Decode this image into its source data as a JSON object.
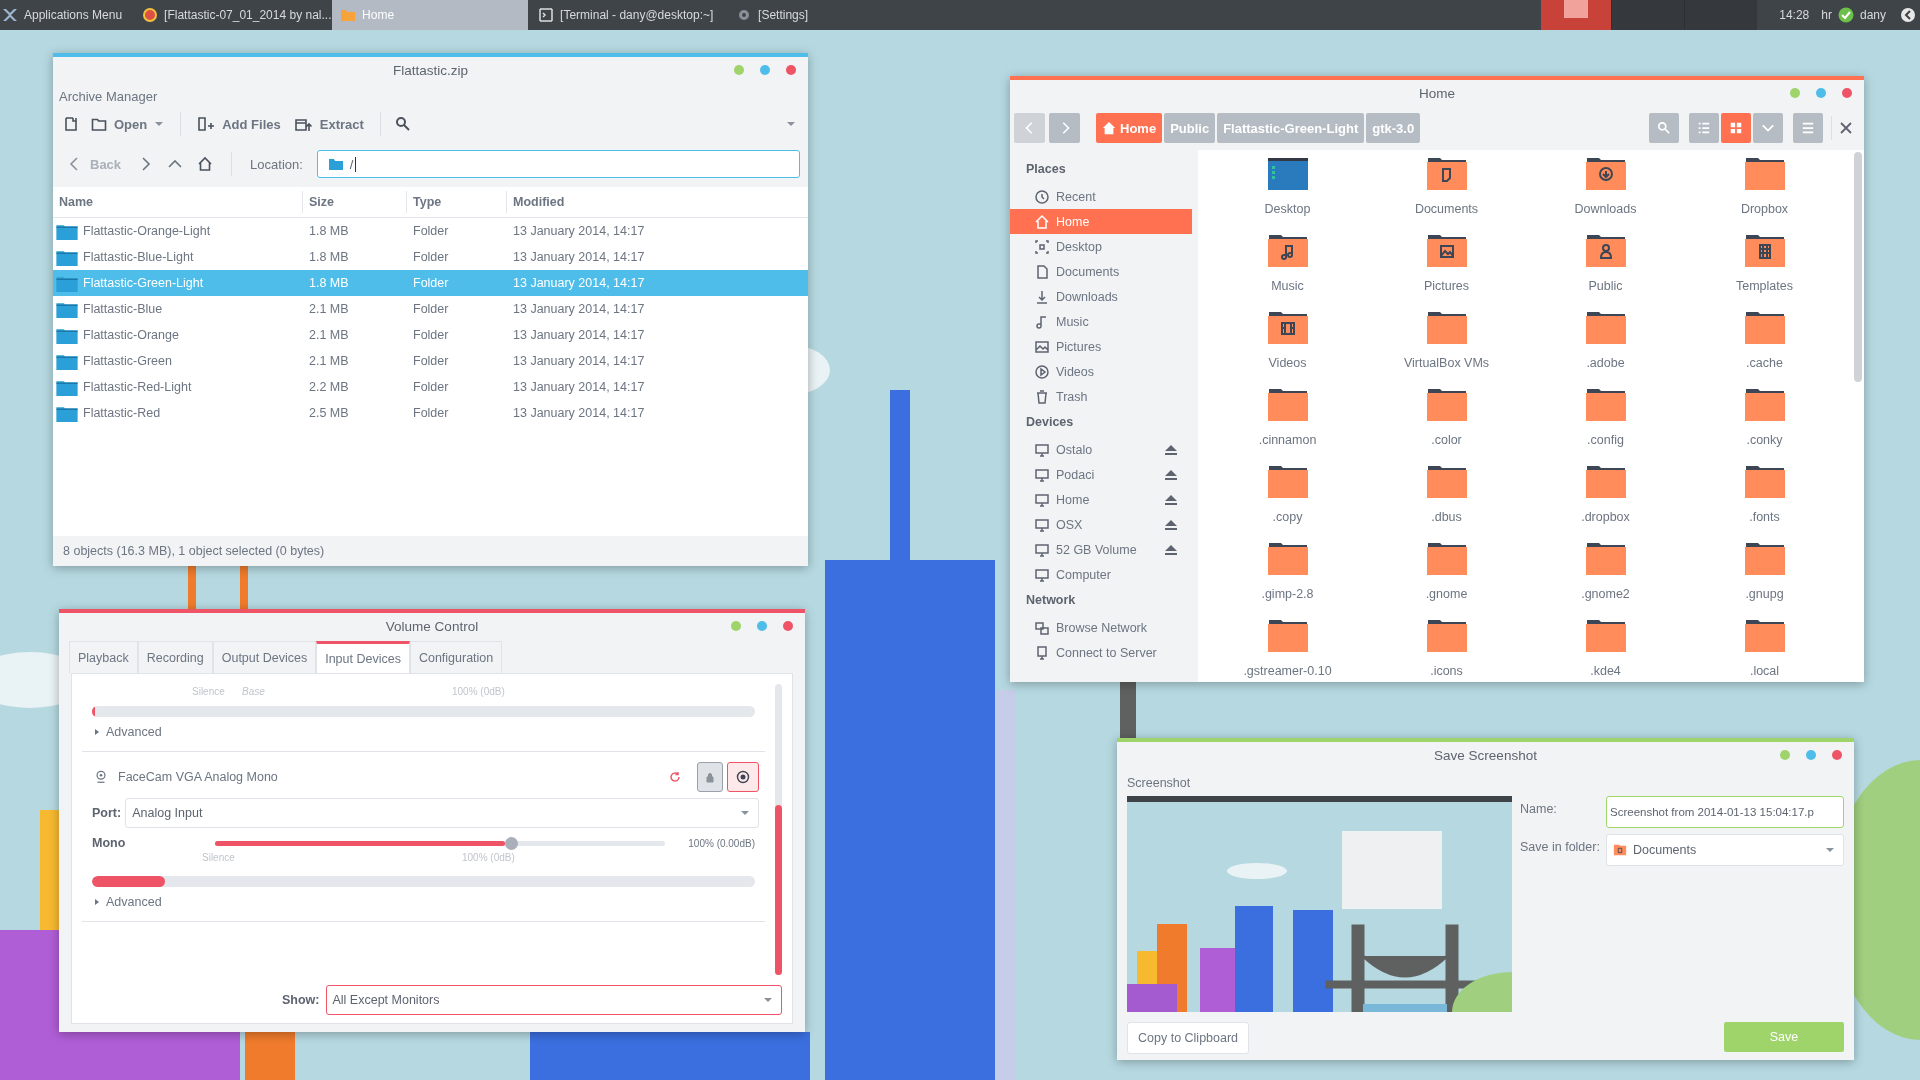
{
  "taskbar": {
    "items": [
      {
        "label": "Applications Menu",
        "kind": "menu",
        "selected": false
      },
      {
        "label": "[Flattastic-07_01_2014 by nal...",
        "kind": "browser",
        "selected": false
      },
      {
        "label": "Home",
        "kind": "folder",
        "selected": true
      },
      {
        "label": "[Terminal - dany@desktop:~]",
        "kind": "terminal",
        "selected": false
      },
      {
        "label": "[Settings]",
        "kind": "settings",
        "selected": false
      }
    ],
    "clock": "14:28",
    "keyboard_layout": "hr",
    "user": "dany"
  },
  "archive_manager": {
    "title": "Flattastic.zip",
    "app_name": "Archive Manager",
    "toolbar": {
      "open": "Open",
      "add_files": "Add Files",
      "extract": "Extract"
    },
    "nav": {
      "back": "Back",
      "location_label": "Location:",
      "location": "/"
    },
    "columns": [
      "Name",
      "Size",
      "Type",
      "Modified"
    ],
    "rows": [
      {
        "name": "Flattastic-Orange-Light",
        "size": "1.8 MB",
        "type": "Folder",
        "modified": "13 January 2014, 14:17",
        "selected": false
      },
      {
        "name": "Flattastic-Blue-Light",
        "size": "1.8 MB",
        "type": "Folder",
        "modified": "13 January 2014, 14:17",
        "selected": false
      },
      {
        "name": "Flattastic-Green-Light",
        "size": "1.8 MB",
        "type": "Folder",
        "modified": "13 January 2014, 14:17",
        "selected": true
      },
      {
        "name": "Flattastic-Blue",
        "size": "2.1 MB",
        "type": "Folder",
        "modified": "13 January 2014, 14:17",
        "selected": false
      },
      {
        "name": "Flattastic-Orange",
        "size": "2.1 MB",
        "type": "Folder",
        "modified": "13 January 2014, 14:17",
        "selected": false
      },
      {
        "name": "Flattastic-Green",
        "size": "2.1 MB",
        "type": "Folder",
        "modified": "13 January 2014, 14:17",
        "selected": false
      },
      {
        "name": "Flattastic-Red-Light",
        "size": "2.2 MB",
        "type": "Folder",
        "modified": "13 January 2014, 14:17",
        "selected": false
      },
      {
        "name": "Flattastic-Red",
        "size": "2.5 MB",
        "type": "Folder",
        "modified": "13 January 2014, 14:17",
        "selected": false
      }
    ],
    "status_bar": "8 objects (16.3 MB), 1 object selected (0 bytes)"
  },
  "file_manager": {
    "title": "Home",
    "breadcrumbs": [
      {
        "label": "Home",
        "selected": true
      },
      {
        "label": "Public",
        "selected": false
      },
      {
        "label": "Flattastic-Green-Light",
        "selected": false
      },
      {
        "label": "gtk-3.0",
        "selected": false
      }
    ],
    "views": [
      {
        "kind": "list",
        "selected": false
      },
      {
        "kind": "icons",
        "selected": true
      }
    ],
    "sidebar": [
      {
        "heading": "Places",
        "items": [
          {
            "label": "Recent",
            "kind": "recent",
            "selected": false
          },
          {
            "label": "Home",
            "kind": "home",
            "selected": true
          },
          {
            "label": "Desktop",
            "kind": "desktop",
            "selected": false
          },
          {
            "label": "Documents",
            "kind": "documents",
            "selected": false
          },
          {
            "label": "Downloads",
            "kind": "downloads",
            "selected": false
          },
          {
            "label": "Music",
            "kind": "music",
            "selected": false
          },
          {
            "label": "Pictures",
            "kind": "pictures",
            "selected": false
          },
          {
            "label": "Videos",
            "kind": "videos",
            "selected": false
          },
          {
            "label": "Trash",
            "kind": "trash",
            "selected": false
          }
        ]
      },
      {
        "heading": "Devices",
        "items": [
          {
            "label": "Ostalo",
            "kind": "drive",
            "selected": false,
            "ejectable": true
          },
          {
            "label": "Podaci",
            "kind": "drive",
            "selected": false,
            "ejectable": true
          },
          {
            "label": "Home",
            "kind": "drive",
            "selected": false,
            "ejectable": true
          },
          {
            "label": "OSX",
            "kind": "drive",
            "selected": false,
            "ejectable": true
          },
          {
            "label": "52 GB Volume",
            "kind": "drive",
            "selected": false,
            "ejectable": true
          },
          {
            "label": "Computer",
            "kind": "drive",
            "selected": false,
            "ejectable": false
          }
        ]
      },
      {
        "heading": "Network",
        "items": [
          {
            "label": "Browse Network",
            "kind": "network",
            "selected": false
          },
          {
            "label": "Connect to Server",
            "kind": "server",
            "selected": false
          }
        ]
      }
    ],
    "items": [
      {
        "label": "Desktop",
        "kind": "desktop"
      },
      {
        "label": "Documents",
        "kind": "documents"
      },
      {
        "label": "Downloads",
        "kind": "downloads"
      },
      {
        "label": "Dropbox",
        "kind": "folder"
      },
      {
        "label": "Music",
        "kind": "music"
      },
      {
        "label": "Pictures",
        "kind": "pictures"
      },
      {
        "label": "Public",
        "kind": "public"
      },
      {
        "label": "Templates",
        "kind": "templates"
      },
      {
        "label": "Videos",
        "kind": "videos"
      },
      {
        "label": "VirtualBox VMs",
        "kind": "folder"
      },
      {
        "label": ".adobe",
        "kind": "folder"
      },
      {
        "label": ".cache",
        "kind": "folder"
      },
      {
        "label": ".cinnamon",
        "kind": "folder"
      },
      {
        "label": ".color",
        "kind": "folder"
      },
      {
        "label": ".config",
        "kind": "folder"
      },
      {
        "label": ".conky",
        "kind": "folder"
      },
      {
        "label": ".copy",
        "kind": "folder"
      },
      {
        "label": ".dbus",
        "kind": "folder"
      },
      {
        "label": ".dropbox",
        "kind": "folder"
      },
      {
        "label": ".fonts",
        "kind": "folder"
      },
      {
        "label": ".gimp-2.8",
        "kind": "folder"
      },
      {
        "label": ".gnome",
        "kind": "folder"
      },
      {
        "label": ".gnome2",
        "kind": "folder"
      },
      {
        "label": ".gnupg",
        "kind": "folder"
      },
      {
        "label": ".gstreamer-0.10",
        "kind": "folder"
      },
      {
        "label": ".icons",
        "kind": "folder"
      },
      {
        "label": ".kde4",
        "kind": "folder"
      },
      {
        "label": ".local",
        "kind": "folder"
      }
    ]
  },
  "volume_control": {
    "title": "Volume Control",
    "tabs": [
      {
        "label": "Playback",
        "selected": false
      },
      {
        "label": "Recording",
        "selected": false
      },
      {
        "label": "Output Devices",
        "selected": false
      },
      {
        "label": "Input Devices",
        "selected": true
      },
      {
        "label": "Configuration",
        "selected": false
      }
    ],
    "upper": {
      "scale_left": "Silence",
      "scale_base": "Base",
      "scale_right": "100% (0dB)",
      "meter": {
        "level": 0.004
      },
      "advanced": "Advanced"
    },
    "device": {
      "name": "FaceCam VGA Analog Mono",
      "port_label": "Port:",
      "port": "Analog Input",
      "channel": "Mono",
      "slider": {
        "level": 0.66
      },
      "reading": "100% (0.00dB)",
      "scale_left": "Silence",
      "scale_right": "100% (0dB)",
      "meter": {
        "level": 0.11
      },
      "advanced": "Advanced"
    },
    "show_label": "Show:",
    "show": "All Except Monitors"
  },
  "save_screenshot": {
    "title": "Save Screenshot",
    "preview_label": "Screenshot",
    "name_label": "Name:",
    "name": "Screenshot from 2014-01-13 15:04:17.p",
    "folder_label": "Save in folder:",
    "folder": "Documents",
    "copy_button": "Copy to Clipboard",
    "save_button": "Save"
  }
}
